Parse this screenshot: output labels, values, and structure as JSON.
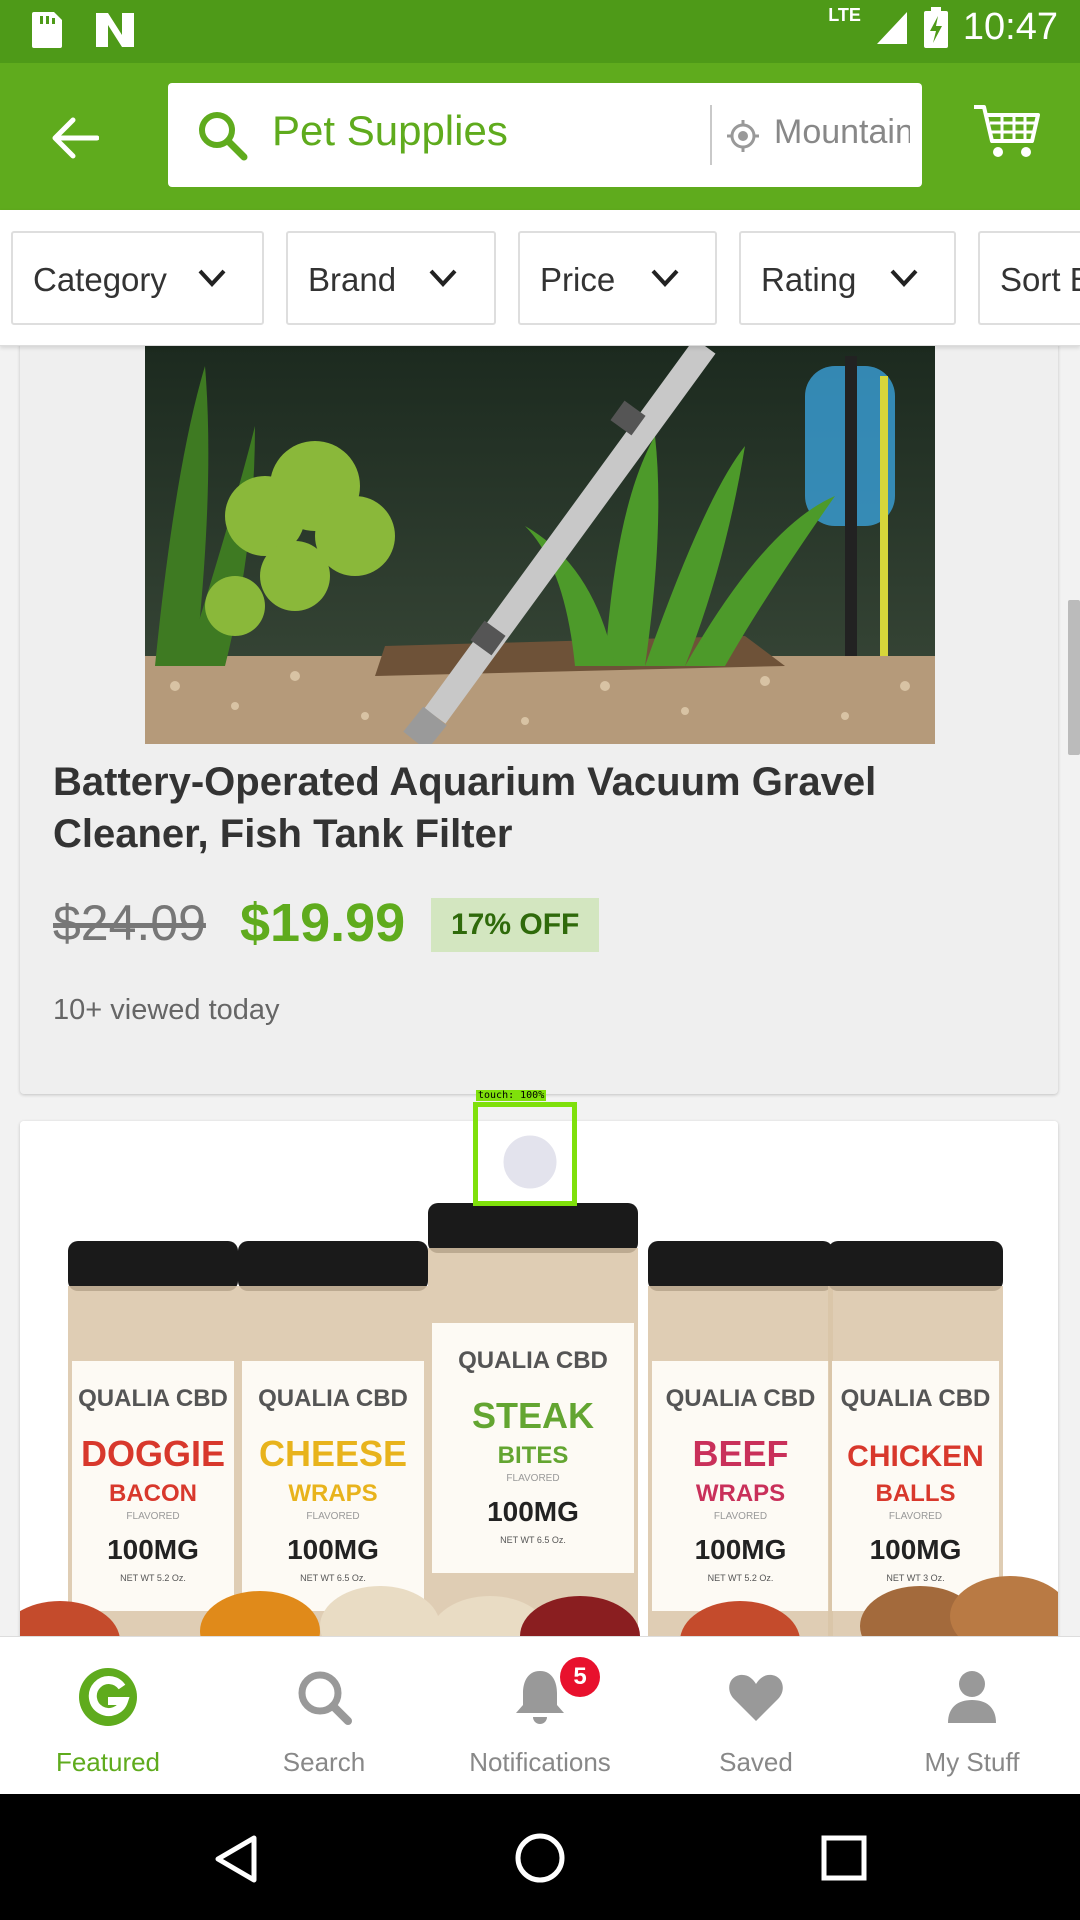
{
  "status_bar": {
    "time": "10:47",
    "network": "LTE",
    "left_icons": [
      "sd-card-icon",
      "n-notification-icon"
    ]
  },
  "search": {
    "query": "Pet Supplies",
    "location": "Mountain"
  },
  "filters": [
    {
      "label": "Category"
    },
    {
      "label": "Brand"
    },
    {
      "label": "Price"
    },
    {
      "label": "Rating"
    },
    {
      "label": "Sort B"
    }
  ],
  "products": [
    {
      "title": "Battery-Operated Aquarium Vacuum Gravel Cleaner, Fish Tank Filter",
      "old_price": "$24.09",
      "new_price": "$19.99",
      "discount": "17% OFF",
      "viewed": "10+ viewed today"
    },
    {
      "jar_labels": [
        {
          "flavor_line1": "DOGGIE",
          "flavor_line2": "BACON",
          "dose": "100MG",
          "color": "#d8382c",
          "weight": "NET WT 5.2 Oz."
        },
        {
          "flavor_line1": "CHEESE",
          "flavor_line2": "WRAPS",
          "dose": "100MG",
          "color": "#e8b31c",
          "weight": "NET WT 6.5 Oz."
        },
        {
          "flavor_line1": "STEAK",
          "flavor_line2": "BITES",
          "dose": "100MG",
          "color": "#63a531",
          "weight": "NET WT 6.5 Oz."
        },
        {
          "flavor_line1": "BEEF",
          "flavor_line2": "WRAPS",
          "dose": "100MG",
          "color": "#c9305a",
          "weight": "NET WT 5.2 Oz."
        },
        {
          "flavor_line1": "CHICKEN",
          "flavor_line2": "BALLS",
          "dose": "100MG",
          "color": "#d8382c",
          "weight": "NET WT 3 Oz."
        }
      ],
      "brand": "QUALIA CBD",
      "sub": "FLAVORED"
    }
  ],
  "touch_indicator": "touch: 100%",
  "bottom_nav": [
    {
      "label": "Featured",
      "icon": "g-logo-icon",
      "active": true
    },
    {
      "label": "Search",
      "icon": "search-icon"
    },
    {
      "label": "Notifications",
      "icon": "bell-icon",
      "badge": "5"
    },
    {
      "label": "Saved",
      "icon": "heart-icon"
    },
    {
      "label": "My Stuff",
      "icon": "person-icon"
    }
  ],
  "colors": {
    "brand_green": "#5fab1d",
    "status_green": "#4e9a18",
    "badge_red": "#e8112d"
  }
}
